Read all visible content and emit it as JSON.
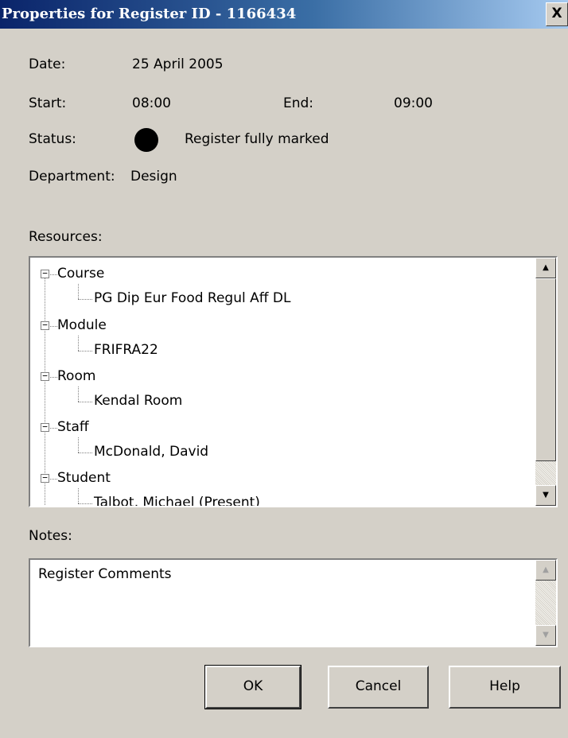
{
  "window": {
    "title": "Properties for Register ID - 1166434",
    "close_label": "X"
  },
  "fields": {
    "date_label": "Date:",
    "date_value": "25 April 2005",
    "start_label": "Start:",
    "start_value": "08:00",
    "end_label": "End:",
    "end_value": "09:00",
    "status_label": "Status:",
    "status_value": "Register fully marked",
    "department_label": "Department:",
    "department_value": "Design"
  },
  "resources": {
    "label": "Resources:",
    "groups": [
      {
        "name": "Course",
        "children": [
          "PG Dip Eur Food Regul Aff DL"
        ]
      },
      {
        "name": "Module",
        "children": [
          "FRIFRA22"
        ]
      },
      {
        "name": "Room",
        "children": [
          "Kendal Room"
        ]
      },
      {
        "name": "Staff",
        "children": [
          "McDonald, David"
        ]
      },
      {
        "name": "Student",
        "children": [
          "Talbot, Michael (Present)"
        ]
      }
    ],
    "expander_symbol": "−"
  },
  "notes": {
    "label": "Notes:",
    "value": "Register Comments"
  },
  "buttons": {
    "ok": "OK",
    "cancel": "Cancel",
    "help": "Help"
  },
  "icons": {
    "status": "filled-circle-icon",
    "scroll_up": "triangle-up-icon",
    "scroll_down": "triangle-down-icon"
  },
  "colors": {
    "titlebar_start": "#0a246a",
    "titlebar_end": "#a6caf0",
    "dialog_bg": "#d4d0c8",
    "status_dot": "#000000"
  }
}
